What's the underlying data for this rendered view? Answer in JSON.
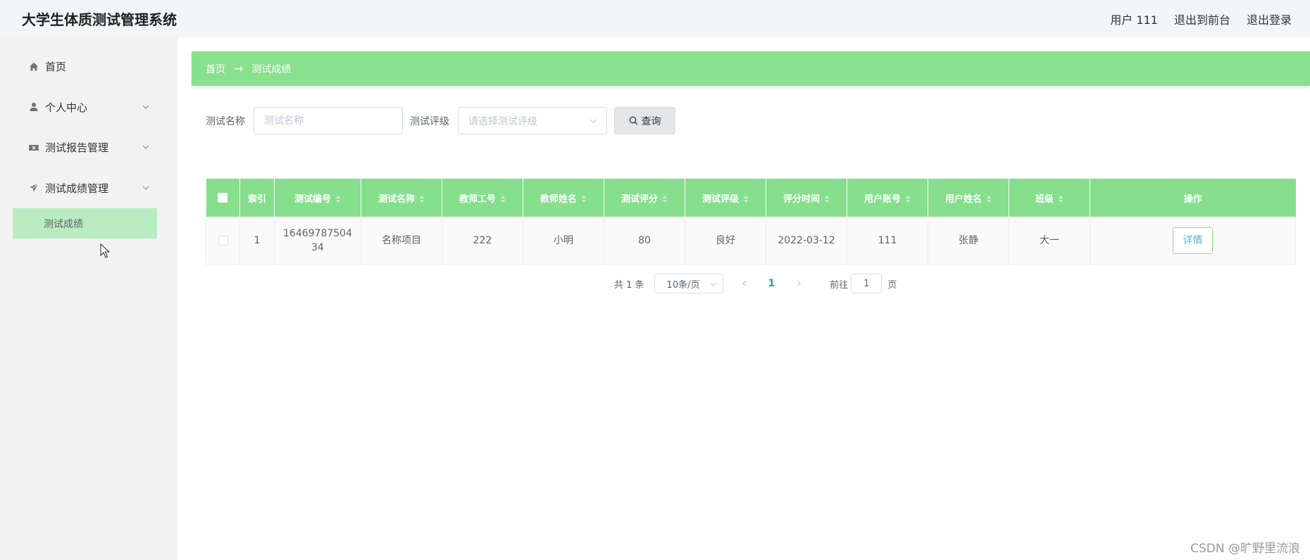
{
  "app": {
    "title": "大学生体质测试管理系统"
  },
  "topbar": {
    "user": "用户 111",
    "frontend": "退出到前台",
    "logout": "退出登录"
  },
  "sidebar": {
    "items": [
      {
        "label": "首页",
        "icon": "home-icon"
      },
      {
        "label": "个人中心",
        "icon": "user-icon"
      },
      {
        "label": "测试报告管理",
        "icon": "ticket-icon"
      },
      {
        "label": "测试成绩管理",
        "icon": "send-icon"
      }
    ],
    "active_sub": "测试成绩"
  },
  "breadcrumb": {
    "home": "首页",
    "separator": "→",
    "current": "测试成绩"
  },
  "search": {
    "name_label": "测试名称",
    "name_placeholder": "测试名称",
    "level_label": "测试评级",
    "level_placeholder": "请选择测试评级",
    "button": "查询"
  },
  "table": {
    "columns": [
      "索引",
      "测试编号",
      "测试名称",
      "教师工号",
      "教师姓名",
      "测试评分",
      "测试评级",
      "评分时间",
      "用户账号",
      "用户姓名",
      "班级",
      "操作"
    ],
    "rows": [
      {
        "index": "1",
        "test_no": "1646978750434",
        "test_name": "名称项目",
        "teacher_id": "222",
        "teacher_name": "小明",
        "score": "80",
        "level": "良好",
        "time": "2022-03-12",
        "account": "111",
        "user_name": "张静",
        "class": "大一",
        "action": "详情"
      }
    ]
  },
  "pagination": {
    "total": "共 1 条",
    "page_size": "10条/页",
    "current": "1",
    "goto_prefix": "前往",
    "goto_value": "1",
    "goto_suffix": "页"
  },
  "watermark": "CSDN @旷野里流浪",
  "colors": {
    "accent": "#89e08d",
    "header": "#85df8c",
    "active_sub": "#b9ecc0",
    "link": "#5bb0d6",
    "page_active": "#1fa39a"
  }
}
